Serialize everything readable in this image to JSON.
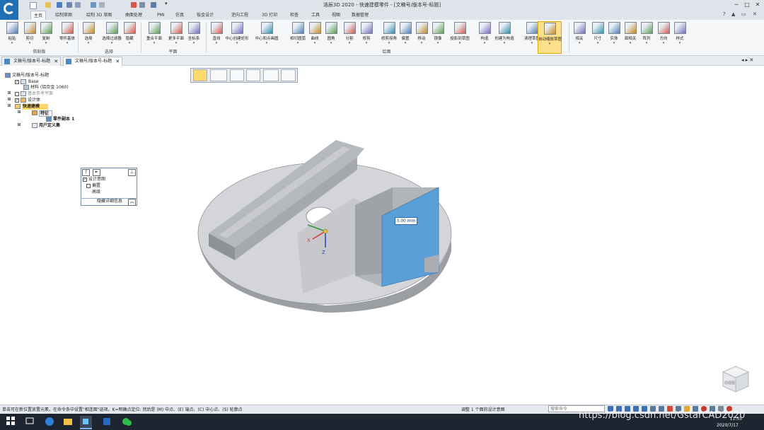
{
  "window": {
    "title": "浩辰3D 2020 - 快速建模零件 - [文稿号/版本号-标题]",
    "min": "─",
    "max": "□",
    "close": "✕"
  },
  "tabs": [
    "主页",
    "绘制草图",
    "绘制 3D 草图",
    "曲面处理",
    "PMI",
    "仿真",
    "钣金设计",
    "逆向工程",
    "3D 打印",
    "检查",
    "工具",
    "视图",
    "数据管理"
  ],
  "active_tab": "主页",
  "ribbon_right": {
    "help": "?",
    "pin": "▲",
    "restore": "▭",
    "close": "✕"
  },
  "ribbon": {
    "groups": [
      {
        "label": "剪贴板",
        "buttons": [
          "粘贴",
          "剪切",
          "复制",
          "零件基体"
        ]
      },
      {
        "label": "选择",
        "buttons": [
          "选择",
          "选择过滤器",
          "隐藏"
        ]
      },
      {
        "label": "平面",
        "buttons": [
          "重合平面",
          "更多平面",
          "坐标系"
        ]
      },
      {
        "label": "绘图",
        "buttons": [
          "直线",
          "中心创建矩形",
          "中心和点画圆",
          "相切圆弧",
          "曲线",
          "圆角",
          "分割",
          "修剪",
          "修剪拐角",
          "偏置",
          "移动",
          "镜像",
          "投影到草图",
          "构造",
          "创建为构造",
          "清理草图",
          "自动缩放草图"
        ]
      },
      {
        "label": "",
        "buttons": [
          "相关",
          "尺寸",
          "实体",
          "面相关",
          "阵列",
          "方向",
          "样式"
        ]
      }
    ]
  },
  "doc_tabs": [
    {
      "label": "文稿号/版本号-标题",
      "close": "✕",
      "active": false
    },
    {
      "label": "文稿号/版本号-标题",
      "close": "✕",
      "active": true
    }
  ],
  "tree": {
    "root": "文稿号/版本号-标题",
    "items": [
      "Base",
      "材料 (铝合金 1060)",
      "基本参考平面",
      "设计体",
      "快速建模",
      "特征",
      "零件副本 1",
      "用户定义集"
    ]
  },
  "panel": {
    "help": "?",
    "play": "►",
    "pin": "⊥",
    "items": [
      "设计意图",
      "偏置",
      "高级"
    ],
    "footer": "隐藏详细信息",
    "collapse": "︽"
  },
  "dimension": {
    "value": "3.00 mm"
  },
  "axes": {
    "x": "X",
    "z": "Z"
  },
  "viewcube": {
    "label": "前视图"
  },
  "status": {
    "left": "单击可在新位置放置元素。在命令条中设置\"相连面\"选项。K=明确点定位: 然后是 (M) 中点、(E) 端点、(C) 中心点、(S) 轮廓点",
    "middle": "调整 1 个面的设计意图",
    "cmd_placeholder": "搜索命令"
  },
  "taskbar": {
    "time": "11:55",
    "date": "2020/7/17",
    "watermark": "https://blog.csdn.net/GstarCAD2020"
  },
  "colors": {
    "accent": "#1f6fb5",
    "highlight_face": "#5b9fd8",
    "active_button": "#ffe08a"
  }
}
